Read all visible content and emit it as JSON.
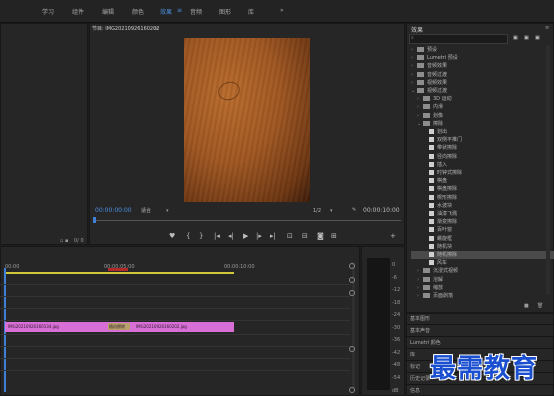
{
  "menu": {
    "items": [
      "学习",
      "组件",
      "编辑",
      "颜色",
      "效果",
      "音频",
      "图形",
      "库"
    ],
    "active_index": 4,
    "more": "»",
    "active_marker": "≡"
  },
  "program": {
    "title": "节目: IMG20210926160202",
    "title_menu": "≡",
    "timecode": "00:00:00:00",
    "fit": "适合",
    "quality": "1/2",
    "duration": "00:00:10:00"
  },
  "transport": {
    "marker": "♥",
    "in": "{",
    "out": "}",
    "go_in": "|◂",
    "step_back": "◂|",
    "play": "▶",
    "step_fwd": "|▸",
    "go_out": "▸|",
    "lift": "⊡",
    "extract": "⊟",
    "export_frame": "◙",
    "compare": "⊞",
    "add": "+"
  },
  "effects": {
    "title": "效果",
    "title_menu": "≡",
    "tree": [
      {
        "label": "预设",
        "type": "folder",
        "depth": 0,
        "expanded": false
      },
      {
        "label": "Lumetri 预设",
        "type": "folder",
        "depth": 0,
        "expanded": false
      },
      {
        "label": "音频效果",
        "type": "folder",
        "depth": 0,
        "expanded": false
      },
      {
        "label": "音频过渡",
        "type": "folder",
        "depth": 0,
        "expanded": false
      },
      {
        "label": "视频效果",
        "type": "folder",
        "depth": 0,
        "expanded": false
      },
      {
        "label": "视频过渡",
        "type": "folder",
        "depth": 0,
        "expanded": true
      },
      {
        "label": "3D 运动",
        "type": "folder",
        "depth": 1,
        "expanded": false
      },
      {
        "label": "内滑",
        "type": "folder",
        "depth": 1,
        "expanded": false
      },
      {
        "label": "划像",
        "type": "folder",
        "depth": 1,
        "expanded": false
      },
      {
        "label": "擦除",
        "type": "folder",
        "depth": 1,
        "expanded": true
      },
      {
        "label": "划出",
        "type": "effect",
        "depth": 2
      },
      {
        "label": "双侧平推门",
        "type": "effect",
        "depth": 2
      },
      {
        "label": "带状擦除",
        "type": "effect",
        "depth": 2
      },
      {
        "label": "径向擦除",
        "type": "effect",
        "depth": 2
      },
      {
        "label": "插入",
        "type": "effect",
        "depth": 2
      },
      {
        "label": "时钟式擦除",
        "type": "effect",
        "depth": 2
      },
      {
        "label": "棋盘",
        "type": "effect",
        "depth": 2
      },
      {
        "label": "棋盘擦除",
        "type": "effect",
        "depth": 2
      },
      {
        "label": "楔形擦除",
        "type": "effect",
        "depth": 2
      },
      {
        "label": "水波块",
        "type": "effect",
        "depth": 2
      },
      {
        "label": "油漆飞溅",
        "type": "effect",
        "depth": 2
      },
      {
        "label": "渐变擦除",
        "type": "effect",
        "depth": 2
      },
      {
        "label": "百叶窗",
        "type": "effect",
        "depth": 2
      },
      {
        "label": "螺旋框",
        "type": "effect",
        "depth": 2
      },
      {
        "label": "随机块",
        "type": "effect",
        "depth": 2
      },
      {
        "label": "随机擦除",
        "type": "effect",
        "depth": 2,
        "selected": true
      },
      {
        "label": "风车",
        "type": "effect",
        "depth": 2
      },
      {
        "label": "沉浸式视频",
        "type": "folder",
        "depth": 1,
        "expanded": false
      },
      {
        "label": "溶解",
        "type": "folder",
        "depth": 1,
        "expanded": false
      },
      {
        "label": "缩放",
        "type": "folder",
        "depth": 1,
        "expanded": false
      },
      {
        "label": "页面剥落",
        "type": "folder",
        "depth": 1,
        "expanded": false
      }
    ]
  },
  "bottom_panels": [
    "基本图形",
    "基本声音",
    "Lumetri 颜色",
    "库",
    "标记",
    "历史记录",
    "信息"
  ],
  "timeline": {
    "ruler": [
      "00:00",
      "00:00:05:00",
      "00:00:10:00"
    ],
    "clip_a": "IMG20210926160134.jpg",
    "transition": "随机擦除",
    "clip_b": "IMG20210926160202.jpg"
  },
  "meter": {
    "ticks": [
      "0",
      "-6",
      "-12",
      "-18",
      "-24",
      "-30",
      "-36",
      "-42",
      "-48",
      "-54"
    ],
    "footer": "dB"
  },
  "left_panel": {
    "icons": "▫ ▪",
    "counter": "0/ 0"
  },
  "watermark": "最需教育",
  "colors": {
    "accent": "#4a90e2",
    "clip": "#d86fd6",
    "playhead": "#3f7fd6",
    "watermark": "#1a4fd0"
  }
}
